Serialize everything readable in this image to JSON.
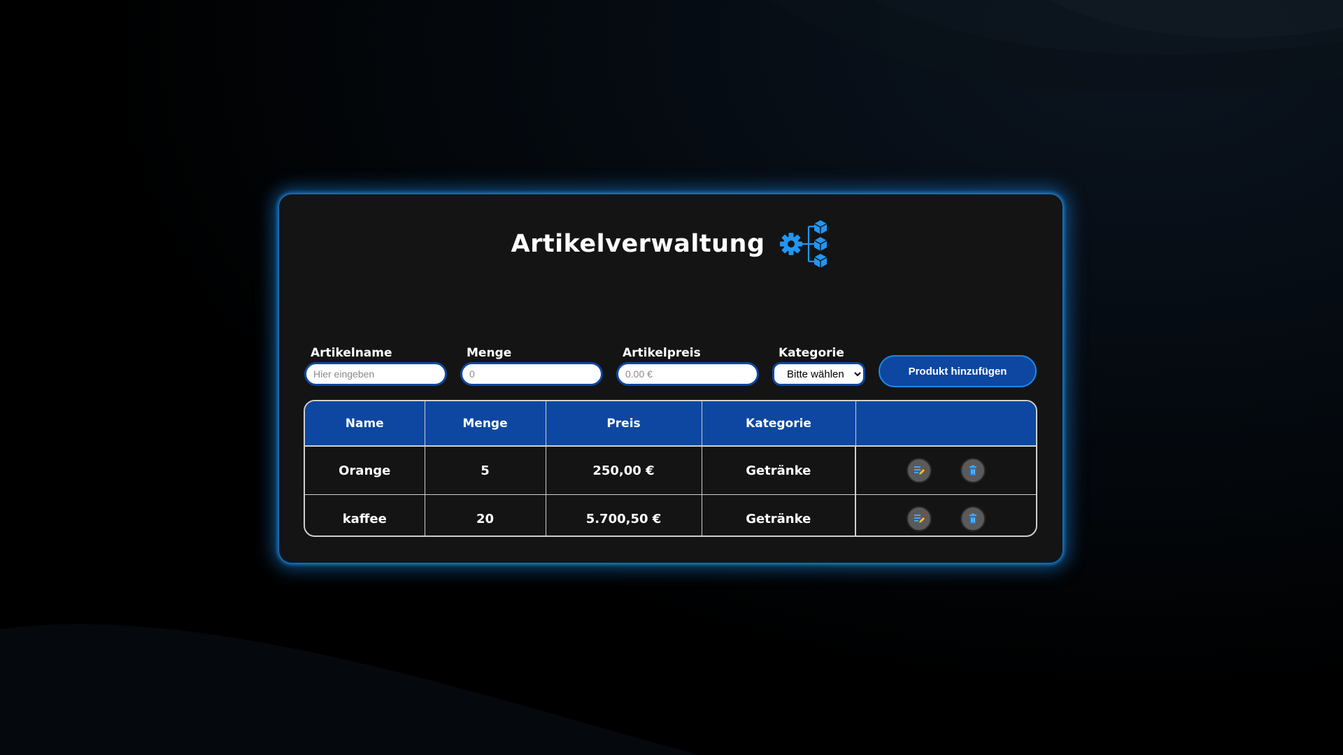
{
  "app": {
    "title": "Artikelverwaltung",
    "logo_icon": "gear-network-icon"
  },
  "form": {
    "name_label": "Artikelname",
    "name_placeholder": "Hier eingeben",
    "quantity_label": "Menge",
    "quantity_placeholder": "0",
    "price_label": "Artikelpreis",
    "price_placeholder": "0.00 €",
    "category_label": "Kategorie",
    "category_selected": "Bitte wählen",
    "add_button_label": "Produkt hinzufügen"
  },
  "table": {
    "headers": [
      "Name",
      "Menge",
      "Preis",
      "Kategorie",
      ""
    ],
    "rows": [
      {
        "name": "Orange",
        "quantity": "5",
        "price": "250,00 €",
        "category": "Getränke"
      },
      {
        "name": "kaffee",
        "quantity": "20",
        "price": "5.700,50 €",
        "category": "Getränke"
      }
    ],
    "edit_icon": "edit-icon",
    "delete_icon": "trash-icon"
  },
  "colors": {
    "accent": "#0d47a1",
    "glow": "#1e88e5",
    "card_bg": "#141414",
    "page_bg": "#000000"
  }
}
